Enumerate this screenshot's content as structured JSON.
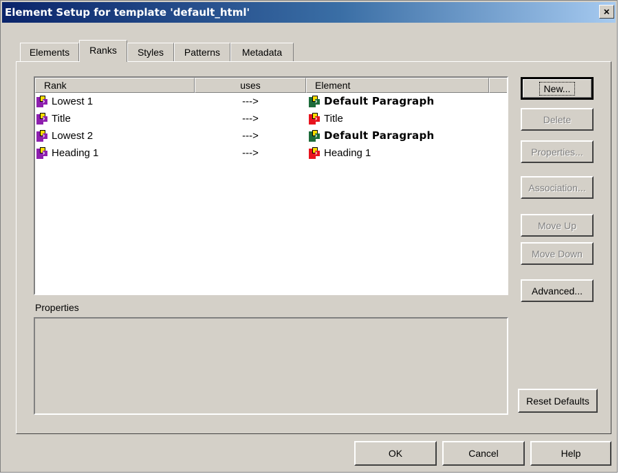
{
  "window": {
    "title": "Element Setup for template 'default_html'",
    "close_glyph": "×"
  },
  "tabs": [
    {
      "label": "Elements",
      "active": false
    },
    {
      "label": "Ranks",
      "active": true
    },
    {
      "label": "Styles",
      "active": false
    },
    {
      "label": "Patterns",
      "active": false
    },
    {
      "label": "Metadata",
      "active": false
    }
  ],
  "ranks_list": {
    "columns": [
      "Rank",
      "uses",
      "Element"
    ],
    "rows": [
      {
        "rank": "Lowest 1",
        "uses": "--->",
        "element": "Default Paragraph",
        "element_bold": true,
        "element_icon": "paragraph-element-icon"
      },
      {
        "rank": "Title",
        "uses": "--->",
        "element": "Title",
        "element_bold": false,
        "element_icon": "heading-element-icon"
      },
      {
        "rank": "Lowest 2",
        "uses": "--->",
        "element": "Default Paragraph",
        "element_bold": true,
        "element_icon": "paragraph-element-icon"
      },
      {
        "rank": "Heading 1",
        "uses": "--->",
        "element": "Heading 1",
        "element_bold": false,
        "element_icon": "heading-element-icon"
      }
    ],
    "rank_icon": "rank-icon"
  },
  "properties": {
    "label": "Properties"
  },
  "side_buttons": {
    "new": "New...",
    "delete": "Delete",
    "properties": "Properties...",
    "association": "Association...",
    "move_up": "Move Up",
    "move_down": "Move Down",
    "advanced": "Advanced...",
    "reset_defaults": "Reset Defaults"
  },
  "footer_buttons": {
    "ok": "OK",
    "cancel": "Cancel",
    "help": "Help"
  },
  "colors": {
    "rank_icon": "#8e1fae",
    "heading_icon": "#e8141e",
    "paragraph_icon": "#1d6b3a",
    "disabled_text": "#808080"
  }
}
